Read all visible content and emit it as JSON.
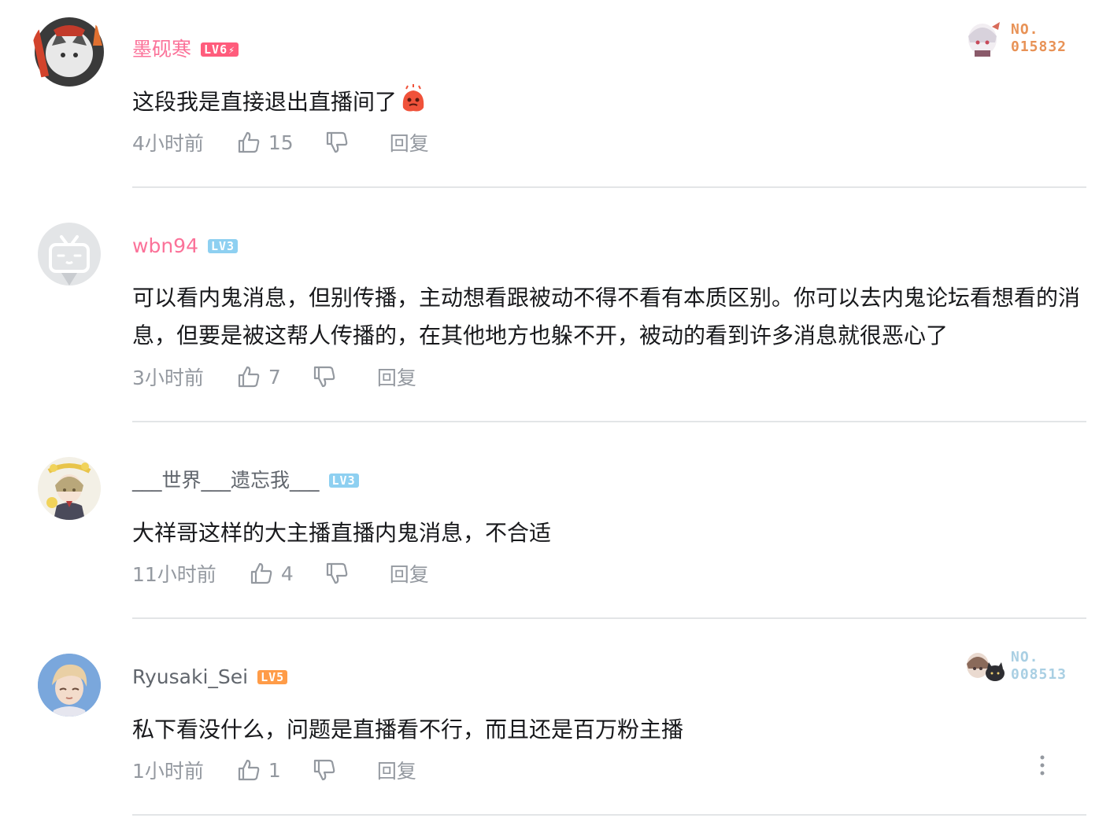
{
  "comments": [
    {
      "username": "墨砚寒",
      "level": "LV6",
      "text": "这段我是直接退出直播间了",
      "time": "4小时前",
      "likes": "15",
      "reply": "回复",
      "badge": {
        "no_label": "NO.",
        "number": "015832"
      }
    },
    {
      "username": "wbn94",
      "level": "LV3",
      "text": "可以看内鬼消息，但别传播，主动想看跟被动不得不看有本质区别。你可以去内鬼论坛看想看的消息，但要是被这帮人传播的，在其他地方也躲不开，被动的看到许多消息就很恶心了",
      "time": "3小时前",
      "likes": "7",
      "reply": "回复"
    },
    {
      "username": "___世界___遗忘我___",
      "level": "LV3",
      "text": "大祥哥这样的大主播直播内鬼消息，不合适",
      "time": "11小时前",
      "likes": "4",
      "reply": "回复"
    },
    {
      "username": "Ryusaki_Sei",
      "level": "LV5",
      "text": "私下看没什么，问题是直播看不行，而且还是百万粉主播",
      "time": "1小时前",
      "likes": "1",
      "reply": "回复",
      "badge": {
        "no_label": "NO.",
        "number": "008513"
      }
    }
  ],
  "colors": {
    "vip_name": "#fb7299",
    "normal_name": "#61666d",
    "text": "#18191c",
    "meta": "#9499a0",
    "divider": "#e3e5e7"
  }
}
